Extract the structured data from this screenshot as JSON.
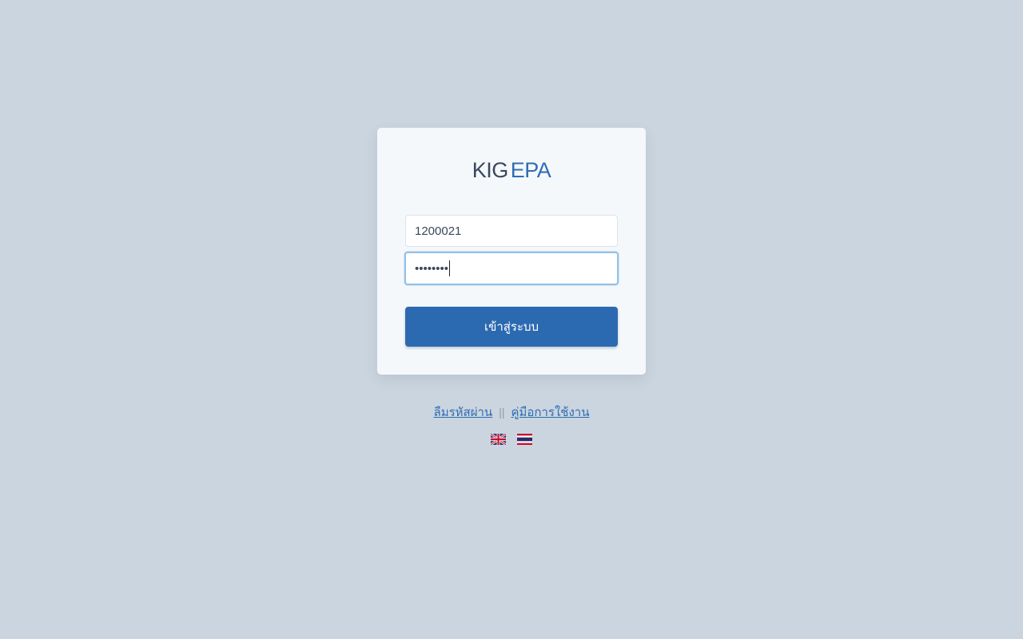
{
  "logo": {
    "part1": "KIG",
    "part2": "EPA"
  },
  "login_form": {
    "username_value": "1200021",
    "password_masked": "••••••••",
    "submit_label": "เข้าสู่ระบบ"
  },
  "links": {
    "forgot_password": "ลืมรหัสผ่าน",
    "separator": "||",
    "user_manual": "คู่มือการใช้งาน"
  },
  "languages": [
    {
      "code": "en",
      "icon": "uk-flag-icon"
    },
    {
      "code": "th",
      "icon": "thai-flag-icon"
    }
  ],
  "colors": {
    "background": "#cbd5df",
    "card": "#f4f8fb",
    "accent": "#2b6ab1",
    "text_dark": "#3a475c"
  }
}
